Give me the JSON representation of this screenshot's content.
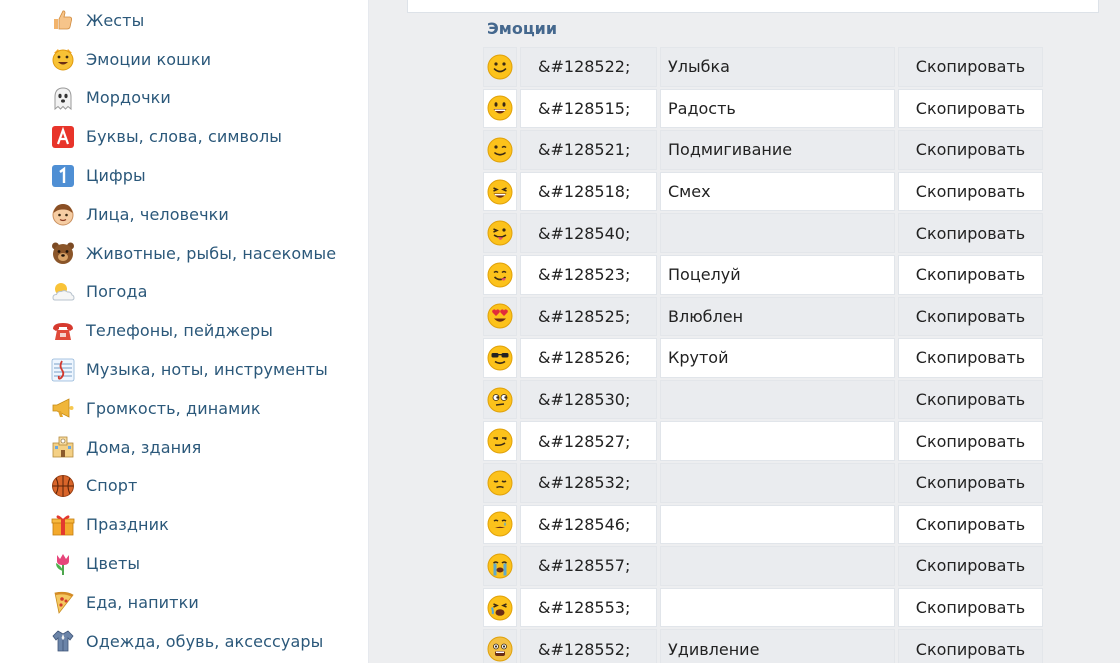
{
  "sidebar": {
    "categories": [
      {
        "label": "Жесты",
        "icon": "thumbs-up-icon"
      },
      {
        "label": "Эмоции кошки",
        "icon": "cat-face-icon"
      },
      {
        "label": "Мордочки",
        "icon": "ghost-icon"
      },
      {
        "label": "Буквы, слова, символы",
        "icon": "letter-a-icon"
      },
      {
        "label": "Цифры",
        "icon": "digit-one-icon"
      },
      {
        "label": "Лица, человечки",
        "icon": "boy-face-icon"
      },
      {
        "label": "Животные, рыбы, насекомые",
        "icon": "bear-face-icon"
      },
      {
        "label": "Погода",
        "icon": "sun-cloud-icon"
      },
      {
        "label": "Телефоны, пейджеры",
        "icon": "telephone-icon"
      },
      {
        "label": "Музыка, ноты, инструменты",
        "icon": "music-score-icon"
      },
      {
        "label": "Громкость, динамик",
        "icon": "horn-icon"
      },
      {
        "label": "Дома, здания",
        "icon": "school-building-icon"
      },
      {
        "label": "Спорт",
        "icon": "basketball-icon"
      },
      {
        "label": "Праздник",
        "icon": "gift-icon"
      },
      {
        "label": "Цветы",
        "icon": "tulip-icon"
      },
      {
        "label": "Еда, напитки",
        "icon": "pizza-icon"
      },
      {
        "label": "Одежда, обувь, аксессуары",
        "icon": "clothes-icon"
      }
    ]
  },
  "main": {
    "section_title": "Эмоции",
    "copy_label": "Скопировать",
    "rows": [
      {
        "code": "&#128522;",
        "name": "Улыбка",
        "emoji": "smiling-face-icon"
      },
      {
        "code": "&#128515;",
        "name": "Радость",
        "emoji": "grinning-face-icon"
      },
      {
        "code": "&#128521;",
        "name": "Подмигивание",
        "emoji": "winking-face-icon"
      },
      {
        "code": "&#128518;",
        "name": "Смех",
        "emoji": "laughing-face-icon"
      },
      {
        "code": "&#128540;",
        "name": "",
        "emoji": "tongue-wink-face-icon"
      },
      {
        "code": "&#128523;",
        "name": "Поцелуй",
        "emoji": "yum-face-icon"
      },
      {
        "code": "&#128525;",
        "name": "Влюблен",
        "emoji": "heart-eyes-face-icon"
      },
      {
        "code": "&#128526;",
        "name": "Крутой",
        "emoji": "sunglasses-face-icon"
      },
      {
        "code": "&#128530;",
        "name": "",
        "emoji": "unamused-face-icon"
      },
      {
        "code": "&#128527;",
        "name": "",
        "emoji": "smirking-face-icon"
      },
      {
        "code": "&#128532;",
        "name": "",
        "emoji": "pensive-face-icon"
      },
      {
        "code": "&#128546;",
        "name": "",
        "emoji": "crying-face-icon"
      },
      {
        "code": "&#128557;",
        "name": "",
        "emoji": "sobbing-face-icon"
      },
      {
        "code": "&#128553;",
        "name": "",
        "emoji": "weary-face-icon"
      },
      {
        "code": "&#128552;",
        "name": "Удивление",
        "emoji": "fearful-face-icon"
      }
    ]
  },
  "colors": {
    "link": "#2b587a",
    "heading": "#45688e",
    "row_alt": "#eaecef",
    "page_bg": "#edeef0",
    "emoji_yellow": "#fcc21b"
  }
}
